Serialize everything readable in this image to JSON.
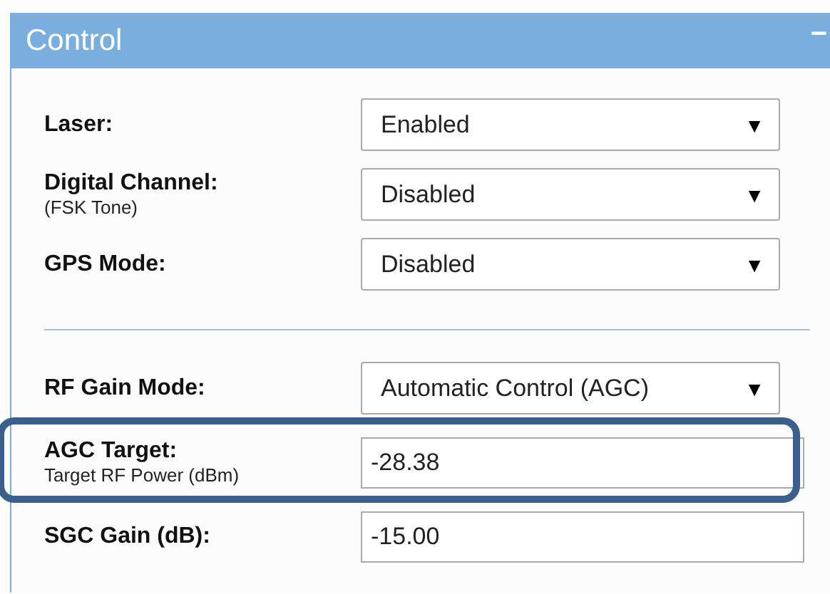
{
  "panel": {
    "title": "Control",
    "collapse": "−"
  },
  "groups": [
    {
      "rows": [
        {
          "kind": "select",
          "label": "Laser:",
          "value": "Enabled",
          "arrow": "▼",
          "highlighted": false
        },
        {
          "kind": "select",
          "label": "Digital Channel:",
          "sublabel": "(FSK Tone)",
          "value": "Disabled",
          "arrow": "▼",
          "highlighted": false
        },
        {
          "kind": "select",
          "label": "GPS Mode:",
          "value": "Disabled",
          "arrow": "▼",
          "highlighted": false
        }
      ]
    },
    {
      "rows": [
        {
          "kind": "select",
          "label": "RF Gain Mode:",
          "value": "Automatic Control (AGC)",
          "arrow": "▼",
          "highlighted": false
        },
        {
          "kind": "input",
          "label": "AGC Target:",
          "sublabel": "Target RF Power (dBm)",
          "value": "-28.38",
          "highlighted": true
        },
        {
          "kind": "input",
          "label": "SGC Gain (dB):",
          "value": "-15.00",
          "highlighted": false
        }
      ]
    }
  ]
}
